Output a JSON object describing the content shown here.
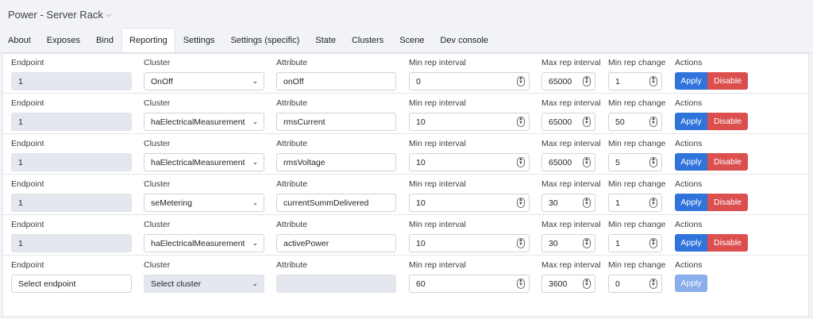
{
  "header": {
    "title": "Power - Server Rack"
  },
  "tabs": [
    {
      "label": "About",
      "active": false
    },
    {
      "label": "Exposes",
      "active": false
    },
    {
      "label": "Bind",
      "active": false
    },
    {
      "label": "Reporting",
      "active": true
    },
    {
      "label": "Settings",
      "active": false
    },
    {
      "label": "Settings (specific)",
      "active": false
    },
    {
      "label": "State",
      "active": false
    },
    {
      "label": "Clusters",
      "active": false
    },
    {
      "label": "Scene",
      "active": false
    },
    {
      "label": "Dev console",
      "active": false
    }
  ],
  "labels": {
    "endpoint": "Endpoint",
    "cluster": "Cluster",
    "attribute": "Attribute",
    "min_interval": "Min rep interval",
    "max_interval": "Max rep interval",
    "min_change": "Min rep change",
    "actions": "Actions",
    "apply": "Apply",
    "disable": "Disable"
  },
  "rows": [
    {
      "endpoint": "1",
      "cluster": "OnOff",
      "attribute": "onOff",
      "min_interval": "0",
      "max_interval": "65000",
      "min_change": "1"
    },
    {
      "endpoint": "1",
      "cluster": "haElectricalMeasurement",
      "attribute": "rmsCurrent",
      "min_interval": "10",
      "max_interval": "65000",
      "min_change": "50"
    },
    {
      "endpoint": "1",
      "cluster": "haElectricalMeasurement",
      "attribute": "rmsVoltage",
      "min_interval": "10",
      "max_interval": "65000",
      "min_change": "5"
    },
    {
      "endpoint": "1",
      "cluster": "seMetering",
      "attribute": "currentSummDelivered",
      "min_interval": "10",
      "max_interval": "30",
      "min_change": "1"
    },
    {
      "endpoint": "1",
      "cluster": "haElectricalMeasurement",
      "attribute": "activePower",
      "min_interval": "10",
      "max_interval": "30",
      "min_change": "1"
    }
  ],
  "new_row": {
    "endpoint_placeholder": "Select endpoint",
    "cluster_placeholder": "Select cluster",
    "attribute": "",
    "min_interval": "60",
    "max_interval": "3600",
    "min_change": "0"
  }
}
